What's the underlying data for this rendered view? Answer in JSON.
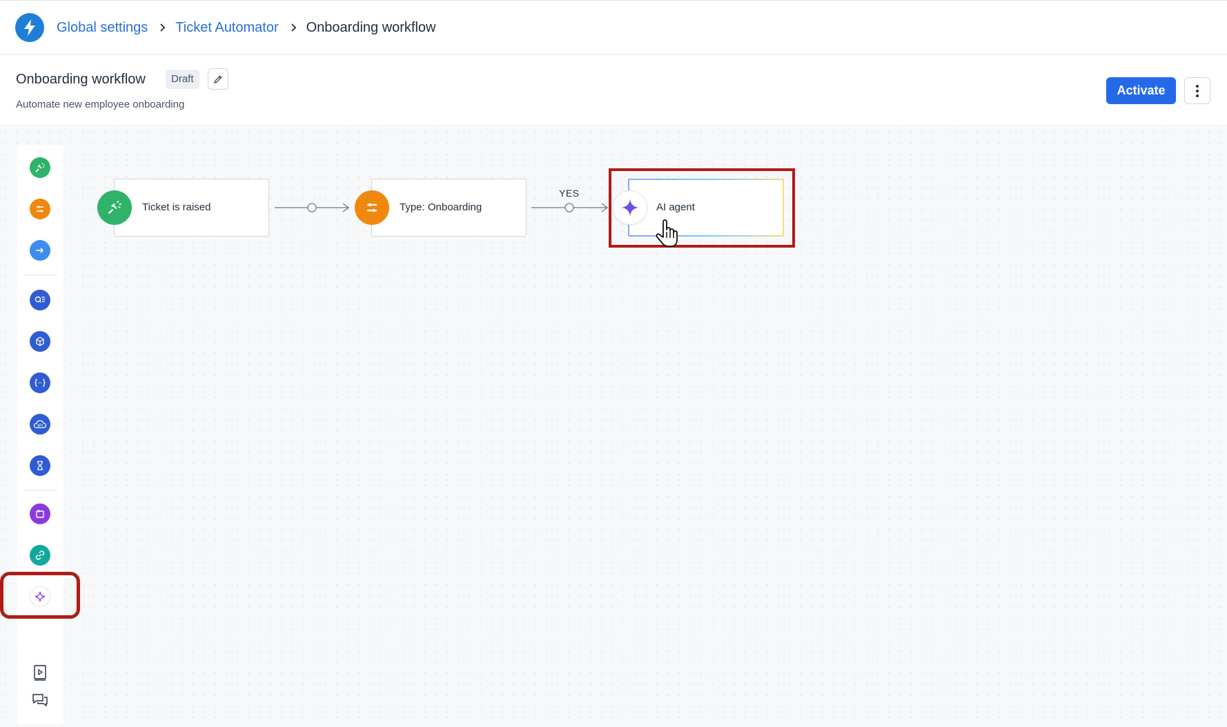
{
  "breadcrumb": {
    "items": [
      {
        "label": "Global settings"
      },
      {
        "label": "Ticket Automator"
      },
      {
        "label": "Onboarding workflow"
      }
    ]
  },
  "workflow": {
    "title": "Onboarding workflow",
    "status": "Draft",
    "description": "Automate new employee onboarding"
  },
  "actions": {
    "activate_label": "Activate"
  },
  "toolbar": {
    "groups": [
      [
        "trigger-icon",
        "condition-icon",
        "action-icon"
      ],
      [
        "search-list-icon",
        "cube-icon",
        "code-braces-icon",
        "api-cloud-icon",
        "hourglass-icon"
      ],
      [
        "app-icon",
        "link-icon",
        "sparkle-icon"
      ]
    ],
    "footer": [
      "video-guide-icon",
      "chat-icon"
    ]
  },
  "flow": {
    "nodes": [
      {
        "label": "Ticket is raised",
        "icon": "trigger-icon",
        "color": "#2fb36b"
      },
      {
        "label": "Type: Onboarding",
        "icon": "condition-icon",
        "color": "#f0870f"
      },
      {
        "label": "AI agent",
        "icon": "sparkle-icon",
        "color": "#7b3fe4"
      }
    ],
    "edge_label": "YES"
  },
  "colors": {
    "accent": "#2469e8",
    "link": "#2a6fd6",
    "highlight": "#b01b16",
    "toolbar_blue": "#2f5bd3",
    "toolbar_purple": "#8a3bdf",
    "toolbar_teal": "#13a89e"
  }
}
